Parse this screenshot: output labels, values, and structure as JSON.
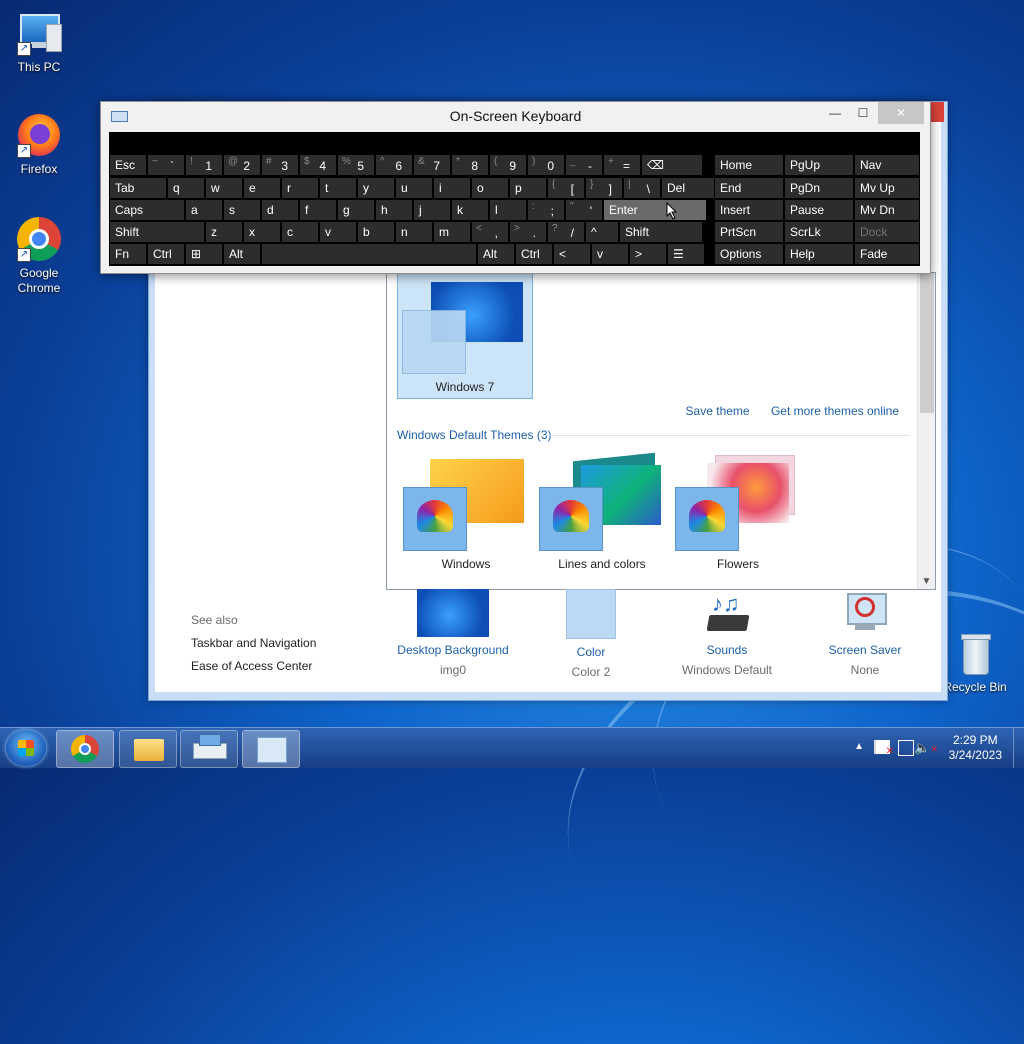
{
  "desktop": {
    "icons": [
      {
        "label": "This PC"
      },
      {
        "label": "Firefox"
      },
      {
        "label": "Google Chrome"
      },
      {
        "label": "Recycle Bin"
      }
    ]
  },
  "osk": {
    "title": "On-Screen Keyboard",
    "rows": [
      [
        {
          "main": "Esc"
        },
        {
          "shift": "~",
          "main": "`"
        },
        {
          "shift": "!",
          "main": "1"
        },
        {
          "shift": "@",
          "main": "2"
        },
        {
          "shift": "#",
          "main": "3"
        },
        {
          "shift": "$",
          "main": "4"
        },
        {
          "shift": "%",
          "main": "5"
        },
        {
          "shift": "^",
          "main": "6"
        },
        {
          "shift": "&",
          "main": "7"
        },
        {
          "shift": "*",
          "main": "8"
        },
        {
          "shift": "(",
          "main": "9"
        },
        {
          "shift": ")",
          "main": "0"
        },
        {
          "shift": "_",
          "main": "-"
        },
        {
          "shift": "+",
          "main": "="
        },
        {
          "main": "⌫"
        }
      ],
      [
        {
          "main": "Tab"
        },
        {
          "main": "q"
        },
        {
          "main": "w"
        },
        {
          "main": "e"
        },
        {
          "main": "r"
        },
        {
          "main": "t"
        },
        {
          "main": "y"
        },
        {
          "main": "u"
        },
        {
          "main": "i"
        },
        {
          "main": "o"
        },
        {
          "main": "p"
        },
        {
          "shift": "{",
          "main": "["
        },
        {
          "shift": "}",
          "main": "]"
        },
        {
          "shift": "|",
          "main": "\\"
        },
        {
          "main": "Del"
        }
      ],
      [
        {
          "main": "Caps"
        },
        {
          "main": "a"
        },
        {
          "main": "s"
        },
        {
          "main": "d"
        },
        {
          "main": "f"
        },
        {
          "main": "g"
        },
        {
          "main": "h"
        },
        {
          "main": "j"
        },
        {
          "main": "k"
        },
        {
          "main": "l"
        },
        {
          "shift": ":",
          "main": ";"
        },
        {
          "shift": "\"",
          "main": "'"
        },
        {
          "main": "Enter"
        }
      ],
      [
        {
          "main": "Shift"
        },
        {
          "main": "z"
        },
        {
          "main": "x"
        },
        {
          "main": "c"
        },
        {
          "main": "v"
        },
        {
          "main": "b"
        },
        {
          "main": "n"
        },
        {
          "main": "m"
        },
        {
          "shift": "<",
          "main": ","
        },
        {
          "shift": ">",
          "main": "."
        },
        {
          "shift": "?",
          "main": "/"
        },
        {
          "main": "^"
        },
        {
          "main": "Shift"
        }
      ],
      [
        {
          "main": "Fn"
        },
        {
          "main": "Ctrl"
        },
        {
          "main": "⊞"
        },
        {
          "main": "Alt"
        },
        {
          "main": ""
        },
        {
          "main": "Alt"
        },
        {
          "main": "Ctrl"
        },
        {
          "main": "<"
        },
        {
          "main": "v"
        },
        {
          "main": ">"
        },
        {
          "main": "☰"
        }
      ]
    ],
    "nav_keys": [
      [
        "Home",
        "PgUp",
        "Nav"
      ],
      [
        "End",
        "PgDn",
        "Mv Up"
      ],
      [
        "Insert",
        "Pause",
        "Mv Dn"
      ],
      [
        "PrtScn",
        "ScrLk",
        "Dock"
      ],
      [
        "Options",
        "Help",
        "Fade"
      ]
    ]
  },
  "personalization": {
    "my_themes": [
      {
        "name": "Windows 7"
      }
    ],
    "links": {
      "save_theme": "Save theme",
      "get_more": "Get more themes online"
    },
    "default_section": "Windows Default Themes (3)",
    "default_themes": [
      {
        "name": "Windows"
      },
      {
        "name": "Lines and colors"
      },
      {
        "name": "Flowers"
      }
    ],
    "see_also": {
      "title": "See also",
      "items": [
        "Taskbar and Navigation",
        "Ease of Access Center"
      ]
    },
    "bottom": [
      {
        "label": "Desktop Background",
        "sub": "img0"
      },
      {
        "label": "Color",
        "sub": "Color 2"
      },
      {
        "label": "Sounds",
        "sub": "Windows Default"
      },
      {
        "label": "Screen Saver",
        "sub": "None"
      }
    ]
  },
  "taskbar": {
    "clock_time": "2:29 PM",
    "clock_date": "3/24/2023"
  }
}
